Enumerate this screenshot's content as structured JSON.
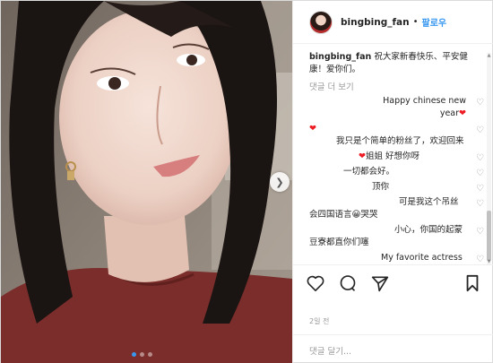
{
  "post": {
    "username": "bingbing_fan",
    "separator": "•",
    "follow_label": "팔로우",
    "caption_text": "祝大家新春快乐、平安健康！爱你们。",
    "more_comments_label": "댓글 더 보기",
    "time": "2일 전",
    "add_comment_placeholder": "댓글 달기..."
  },
  "comments": [
    {
      "text": "Happy chinese new year",
      "suffix": "❤",
      "prefix": ""
    },
    {
      "text": "我只是个简单的粉丝了，欢迎回来",
      "prefix": "❤",
      "suffix": ""
    },
    {
      "text": "姐姐 好想你呀",
      "prefix": "❤",
      "suffix": ""
    },
    {
      "text": "一切都会好。",
      "prefix": "",
      "suffix": ""
    },
    {
      "text": "顶你",
      "prefix": "",
      "suffix": ""
    },
    {
      "text": "可是我这个吊丝会四国语言😀哭哭",
      "prefix": "",
      "suffix": ""
    },
    {
      "text": "小心，你国的起蒙豆寮都直你们噻",
      "prefix": "",
      "suffix": ""
    },
    {
      "text": "My favorite actress is finally back, love uuu",
      "prefix": "",
      "suffix": "❤❤❤"
    }
  ],
  "icons": {
    "like": "heart-outline-icon",
    "comment": "comment-bubble-icon",
    "share": "paper-plane-icon",
    "save": "bookmark-icon",
    "next": "chevron-right-icon"
  },
  "carousel": {
    "count": 3,
    "active_index": 1
  },
  "colors": {
    "accent": "#3897f0",
    "heart": "#ed1c24",
    "muted": "#999999",
    "shirt": "#7a2d2a"
  }
}
